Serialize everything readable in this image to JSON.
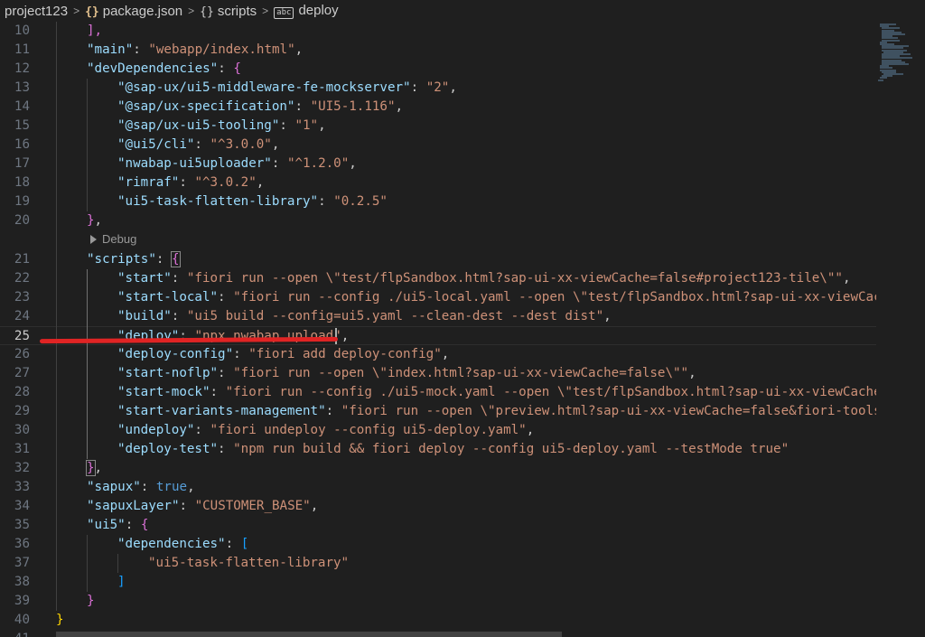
{
  "breadcrumb": {
    "items": [
      {
        "label": "project123",
        "icon": ""
      },
      {
        "label": "package.json",
        "icon": "{}"
      },
      {
        "label": "scripts",
        "icon": "{}"
      },
      {
        "label": "deploy",
        "icon": "abc"
      }
    ],
    "separator": ">"
  },
  "editor": {
    "current_line": 25,
    "codelens_label": "Debug",
    "lines": [
      {
        "num": "10",
        "indent": 1,
        "tokens": [
          {
            "t": "],",
            "c": "b2"
          }
        ]
      },
      {
        "num": "11",
        "indent": 1,
        "tokens": [
          {
            "t": "\"main\"",
            "c": "k"
          },
          {
            "t": ": ",
            "c": "p"
          },
          {
            "t": "\"webapp/index.html\"",
            "c": "s"
          },
          {
            "t": ",",
            "c": "p"
          }
        ]
      },
      {
        "num": "12",
        "indent": 1,
        "tokens": [
          {
            "t": "\"devDependencies\"",
            "c": "k"
          },
          {
            "t": ": ",
            "c": "p"
          },
          {
            "t": "{",
            "c": "b2"
          }
        ]
      },
      {
        "num": "13",
        "indent": 2,
        "tokens": [
          {
            "t": "\"@sap-ux/ui5-middleware-fe-mockserver\"",
            "c": "k"
          },
          {
            "t": ": ",
            "c": "p"
          },
          {
            "t": "\"2\"",
            "c": "s"
          },
          {
            "t": ",",
            "c": "p"
          }
        ]
      },
      {
        "num": "14",
        "indent": 2,
        "tokens": [
          {
            "t": "\"@sap/ux-specification\"",
            "c": "k"
          },
          {
            "t": ": ",
            "c": "p"
          },
          {
            "t": "\"UI5-1.116\"",
            "c": "s"
          },
          {
            "t": ",",
            "c": "p"
          }
        ]
      },
      {
        "num": "15",
        "indent": 2,
        "tokens": [
          {
            "t": "\"@sap/ux-ui5-tooling\"",
            "c": "k"
          },
          {
            "t": ": ",
            "c": "p"
          },
          {
            "t": "\"1\"",
            "c": "s"
          },
          {
            "t": ",",
            "c": "p"
          }
        ]
      },
      {
        "num": "16",
        "indent": 2,
        "tokens": [
          {
            "t": "\"@ui5/cli\"",
            "c": "k"
          },
          {
            "t": ": ",
            "c": "p"
          },
          {
            "t": "\"^3.0.0\"",
            "c": "s"
          },
          {
            "t": ",",
            "c": "p"
          }
        ]
      },
      {
        "num": "17",
        "indent": 2,
        "tokens": [
          {
            "t": "\"nwabap-ui5uploader\"",
            "c": "k"
          },
          {
            "t": ": ",
            "c": "p"
          },
          {
            "t": "\"^1.2.0\"",
            "c": "s"
          },
          {
            "t": ",",
            "c": "p"
          }
        ]
      },
      {
        "num": "18",
        "indent": 2,
        "tokens": [
          {
            "t": "\"rimraf\"",
            "c": "k"
          },
          {
            "t": ": ",
            "c": "p"
          },
          {
            "t": "\"^3.0.2\"",
            "c": "s"
          },
          {
            "t": ",",
            "c": "p"
          }
        ]
      },
      {
        "num": "19",
        "indent": 2,
        "tokens": [
          {
            "t": "\"ui5-task-flatten-library\"",
            "c": "k"
          },
          {
            "t": ": ",
            "c": "p"
          },
          {
            "t": "\"0.2.5\"",
            "c": "s"
          }
        ]
      },
      {
        "num": "20",
        "indent": 1,
        "tokens": [
          {
            "t": "}",
            "c": "b2"
          },
          {
            "t": ",",
            "c": "p"
          }
        ]
      },
      {
        "num": "21",
        "indent": 1,
        "tokens": [
          {
            "t": "\"scripts\"",
            "c": "k"
          },
          {
            "t": ": ",
            "c": "p"
          },
          {
            "t": "{",
            "c": "b2",
            "hl": true
          }
        ]
      },
      {
        "num": "22",
        "indent": 2,
        "tokens": [
          {
            "t": "\"start\"",
            "c": "k"
          },
          {
            "t": ": ",
            "c": "p"
          },
          {
            "t": "\"fiori run --open \\\"test/flpSandbox.html?sap-ui-xx-viewCache=false#project123-tile\\\"\"",
            "c": "s"
          },
          {
            "t": ",",
            "c": "p"
          }
        ]
      },
      {
        "num": "23",
        "indent": 2,
        "tokens": [
          {
            "t": "\"start-local\"",
            "c": "k"
          },
          {
            "t": ": ",
            "c": "p"
          },
          {
            "t": "\"fiori run --config ./ui5-local.yaml --open \\\"test/flpSandbox.html?sap-ui-xx-viewCac",
            "c": "s"
          }
        ]
      },
      {
        "num": "24",
        "indent": 2,
        "tokens": [
          {
            "t": "\"build\"",
            "c": "k"
          },
          {
            "t": ": ",
            "c": "p"
          },
          {
            "t": "\"ui5 build --config=ui5.yaml --clean-dest --dest dist\"",
            "c": "s"
          },
          {
            "t": ",",
            "c": "p"
          }
        ]
      },
      {
        "num": "25",
        "indent": 2,
        "tokens": [
          {
            "t": "\"deploy\"",
            "c": "k"
          },
          {
            "t": ": ",
            "c": "p"
          },
          {
            "t": "\"npx nwabap upload\"",
            "c": "s"
          },
          {
            "t": ",",
            "c": "p"
          }
        ]
      },
      {
        "num": "26",
        "indent": 2,
        "tokens": [
          {
            "t": "\"deploy-config\"",
            "c": "k"
          },
          {
            "t": ": ",
            "c": "p"
          },
          {
            "t": "\"fiori add deploy-config\"",
            "c": "s"
          },
          {
            "t": ",",
            "c": "p"
          }
        ]
      },
      {
        "num": "27",
        "indent": 2,
        "tokens": [
          {
            "t": "\"start-noflp\"",
            "c": "k"
          },
          {
            "t": ": ",
            "c": "p"
          },
          {
            "t": "\"fiori run --open \\\"index.html?sap-ui-xx-viewCache=false\\\"\"",
            "c": "s"
          },
          {
            "t": ",",
            "c": "p"
          }
        ]
      },
      {
        "num": "28",
        "indent": 2,
        "tokens": [
          {
            "t": "\"start-mock\"",
            "c": "k"
          },
          {
            "t": ": ",
            "c": "p"
          },
          {
            "t": "\"fiori run --config ./ui5-mock.yaml --open \\\"test/flpSandbox.html?sap-ui-xx-viewCache",
            "c": "s"
          }
        ]
      },
      {
        "num": "29",
        "indent": 2,
        "tokens": [
          {
            "t": "\"start-variants-management\"",
            "c": "k"
          },
          {
            "t": ": ",
            "c": "p"
          },
          {
            "t": "\"fiori run --open \\\"preview.html?sap-ui-xx-viewCache=false&fiori-tools",
            "c": "s"
          }
        ]
      },
      {
        "num": "30",
        "indent": 2,
        "tokens": [
          {
            "t": "\"undeploy\"",
            "c": "k"
          },
          {
            "t": ": ",
            "c": "p"
          },
          {
            "t": "\"fiori undeploy --config ui5-deploy.yaml\"",
            "c": "s"
          },
          {
            "t": ",",
            "c": "p"
          }
        ]
      },
      {
        "num": "31",
        "indent": 2,
        "tokens": [
          {
            "t": "\"deploy-test\"",
            "c": "k"
          },
          {
            "t": ": ",
            "c": "p"
          },
          {
            "t": "\"npm run build && fiori deploy --config ui5-deploy.yaml --testMode true\"",
            "c": "s"
          }
        ]
      },
      {
        "num": "32",
        "indent": 1,
        "tokens": [
          {
            "t": "}",
            "c": "b2",
            "hl": true
          },
          {
            "t": ",",
            "c": "p"
          }
        ]
      },
      {
        "num": "33",
        "indent": 1,
        "tokens": [
          {
            "t": "\"sapux\"",
            "c": "k"
          },
          {
            "t": ": ",
            "c": "p"
          },
          {
            "t": "true",
            "c": "kw"
          },
          {
            "t": ",",
            "c": "p"
          }
        ]
      },
      {
        "num": "34",
        "indent": 1,
        "tokens": [
          {
            "t": "\"sapuxLayer\"",
            "c": "k"
          },
          {
            "t": ": ",
            "c": "p"
          },
          {
            "t": "\"CUSTOMER_BASE\"",
            "c": "s"
          },
          {
            "t": ",",
            "c": "p"
          }
        ]
      },
      {
        "num": "35",
        "indent": 1,
        "tokens": [
          {
            "t": "\"ui5\"",
            "c": "k"
          },
          {
            "t": ": ",
            "c": "p"
          },
          {
            "t": "{",
            "c": "b2"
          }
        ]
      },
      {
        "num": "36",
        "indent": 2,
        "tokens": [
          {
            "t": "\"dependencies\"",
            "c": "k"
          },
          {
            "t": ": ",
            "c": "p"
          },
          {
            "t": "[",
            "c": "b3"
          }
        ]
      },
      {
        "num": "37",
        "indent": 3,
        "tokens": [
          {
            "t": "\"ui5-task-flatten-library\"",
            "c": "s"
          }
        ]
      },
      {
        "num": "38",
        "indent": 2,
        "tokens": [
          {
            "t": "]",
            "c": "b3"
          }
        ]
      },
      {
        "num": "39",
        "indent": 1,
        "tokens": [
          {
            "t": "}",
            "c": "b2"
          }
        ]
      },
      {
        "num": "40",
        "indent": 0,
        "tokens": [
          {
            "t": "}",
            "c": "b1"
          }
        ]
      },
      {
        "num": "41",
        "indent": 0,
        "tokens": []
      }
    ]
  },
  "annotation": {
    "color": "#e02424"
  }
}
